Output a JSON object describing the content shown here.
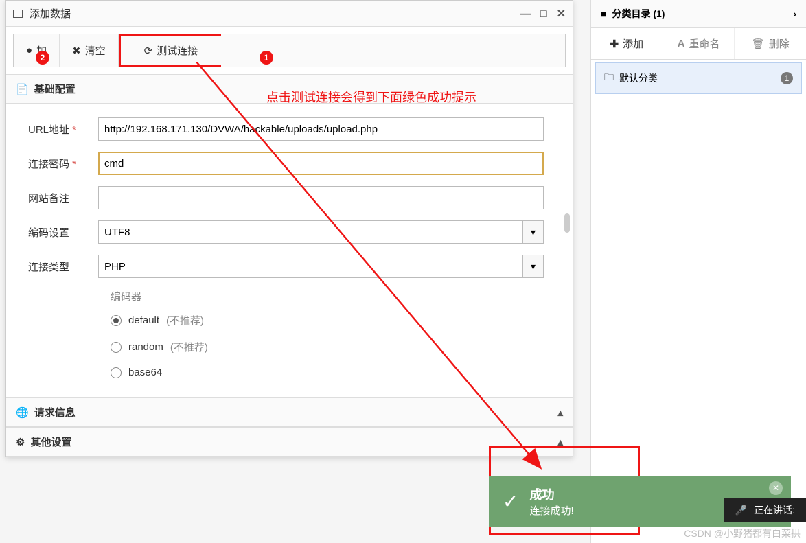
{
  "dialog": {
    "title": "添加数据",
    "toolbar": {
      "add": "加",
      "clear": "清空",
      "test": "测试连接"
    },
    "annotation": "点击测试连接会得到下面绿色成功提示",
    "badges": {
      "one": "1",
      "two": "2"
    },
    "sections": {
      "basic": "基础配置",
      "request": "请求信息",
      "other": "其他设置"
    },
    "form": {
      "url_label": "URL地址",
      "url_value": "http://192.168.171.130/DVWA/hackable/uploads/upload.php",
      "pwd_label": "连接密码",
      "pwd_value": "cmd",
      "note_label": "网站备注",
      "note_value": "",
      "enc_label": "编码设置",
      "enc_value": "UTF8",
      "type_label": "连接类型",
      "type_value": "PHP"
    },
    "encoder": {
      "title": "编码器",
      "hint": "(不推荐)",
      "opt_default": "default",
      "opt_random": "random",
      "opt_base64": "base64"
    }
  },
  "sidebar": {
    "title": "分类目录 (1)",
    "actions": {
      "add": "添加",
      "rename": "重命名",
      "delete": "删除"
    },
    "item": {
      "label": "默认分类",
      "count": "1"
    }
  },
  "toast": {
    "title": "成功",
    "message": "连接成功!"
  },
  "voice": "正在讲话:",
  "watermark": "CSDN @小野猪都有白菜拱"
}
